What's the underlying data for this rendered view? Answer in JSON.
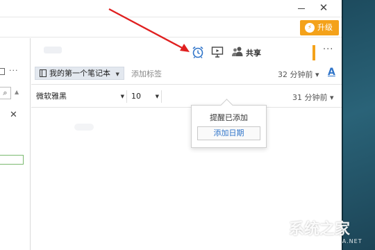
{
  "titlebar": {
    "close_glyph": "✕"
  },
  "topbar": {
    "upgrade_label": "升级",
    "upgrade_icon": "⚡"
  },
  "sidebar": {
    "more_glyph": "···",
    "search_glyph": "🔍",
    "scroll_glyph": "▲",
    "close_glyph": "✕"
  },
  "header": {
    "share_label": "共享",
    "more_glyph": "···"
  },
  "meta": {
    "notebook_label": "我的第一个笔记本",
    "notebook_caret": "▼",
    "add_tag_label": "添加标签",
    "modified_time": "32 分钟前",
    "modified_caret": "▾",
    "font_a": "A"
  },
  "format": {
    "font_family": "微软雅黑",
    "font_size": "10",
    "caret": "▼",
    "created_time": "31 分钟前",
    "created_caret": "▾"
  },
  "tooltip": {
    "message": "提醒已添加",
    "button_label": "添加日期"
  },
  "watermark": {
    "brand": "系统之家",
    "url": "XITONGZHIJIA.NET"
  },
  "colors": {
    "accent_orange": "#f4a21a",
    "link_blue": "#2f74c9",
    "arrow_red": "#e02020"
  }
}
